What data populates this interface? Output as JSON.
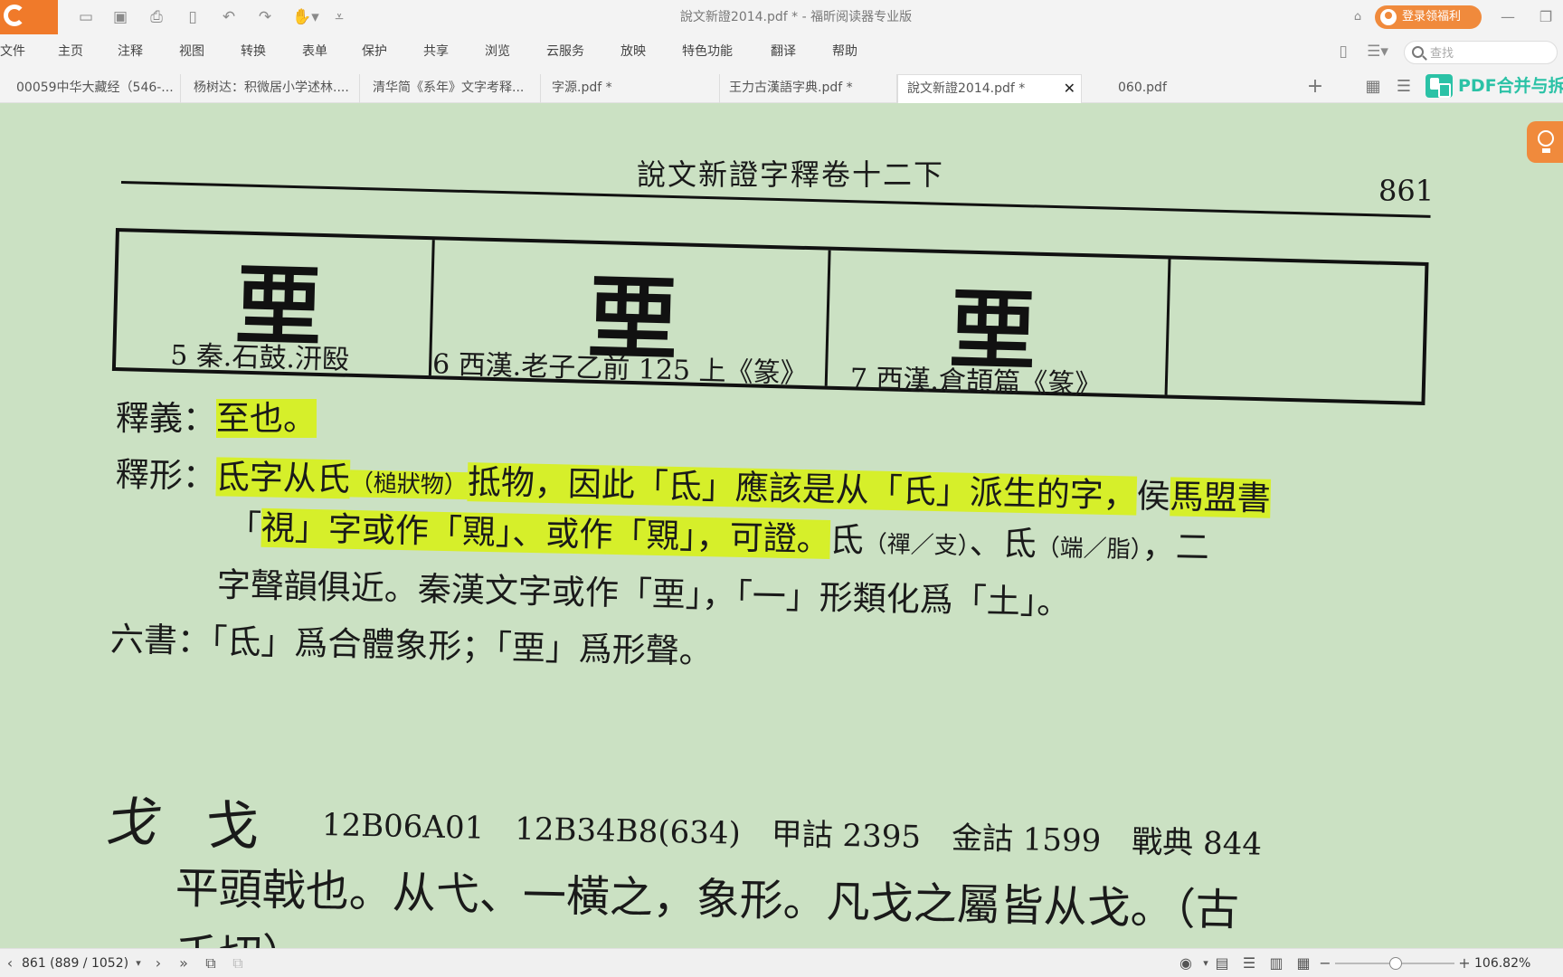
{
  "window": {
    "title": "說文新證2014.pdf * - 福昕阅读器专业版",
    "login_label": "登录领福利"
  },
  "menu": {
    "items": [
      "文件",
      "主页",
      "注释",
      "视图",
      "转换",
      "表单",
      "保护",
      "共享",
      "浏览",
      "云服务",
      "放映",
      "特色功能",
      "翻译",
      "帮助"
    ],
    "search_placeholder": "查找"
  },
  "tabs": [
    {
      "label": "00059中华大藏经（546-..."
    },
    {
      "label": "杨树达：积微居小学述林...."
    },
    {
      "label": "清华简《系年》文字考释..."
    },
    {
      "label": "字源.pdf *"
    },
    {
      "label": "王力古漢語字典.pdf *"
    },
    {
      "label": "說文新證2014.pdf *",
      "active": true
    },
    {
      "label": "060.pdf"
    }
  ],
  "pdf_merge_label": "PDF合并与拆",
  "document": {
    "header_title": "說文新證字釋卷十二下",
    "page_number": "861",
    "glyph_cells": [
      {
        "glyph": "垔",
        "caption": "5 秦.石鼓.汧殹"
      },
      {
        "glyph": "垔",
        "caption": "6 西漢.老子乙前 125 上《篆》"
      },
      {
        "glyph": "垔",
        "caption": "7 西漢.倉頡篇《篆》"
      },
      {
        "glyph": "",
        "caption": ""
      }
    ],
    "shiyi": {
      "label": "釋義：",
      "text": "至也。"
    },
    "shixing": {
      "label": "釋形：",
      "l1_a": "氐字从氏",
      "l1_small": "（槌狀物）",
      "l1_b": "抵物，因此「氐」應該是从「氏」派生的字，",
      "l1_c": "侯",
      "l1_d": "馬盟書",
      "l2_a": "「",
      "l2_b": "視」字或作「覭」、或作「覭」，可證。",
      "l2_c": "氐",
      "l2_small1": "（禪／支）",
      "l2_d": "、氐",
      "l2_small2": "（端／脂）",
      "l2_e": "，二",
      "l3": "字聲韻俱近。秦漢文字或作「垔」，「一」形類化爲「土」。"
    },
    "liushu": {
      "label": "六書：",
      "text": "「氐」爲合體象形；「垔」爲形聲。"
    },
    "next_entry": {
      "seal": "戈",
      "char": "戈",
      "codes": "12B06A01　12B34B8(634)　甲詁 2395　金詁 1599　戰典 844",
      "definition": "平頭戟也。从弋、一橫之，象形。凡戈之屬皆从戈。（古",
      "definition_cont": "禾切）"
    }
  },
  "status": {
    "page_indicator": "861 (889 / 1052)",
    "zoom": "106.82%"
  },
  "colors": {
    "brand_orange": "#f07a2a",
    "document_bg": "#cbe1c3",
    "highlight": "#d6ef2a",
    "merge_accent": "#2bc2a6"
  }
}
